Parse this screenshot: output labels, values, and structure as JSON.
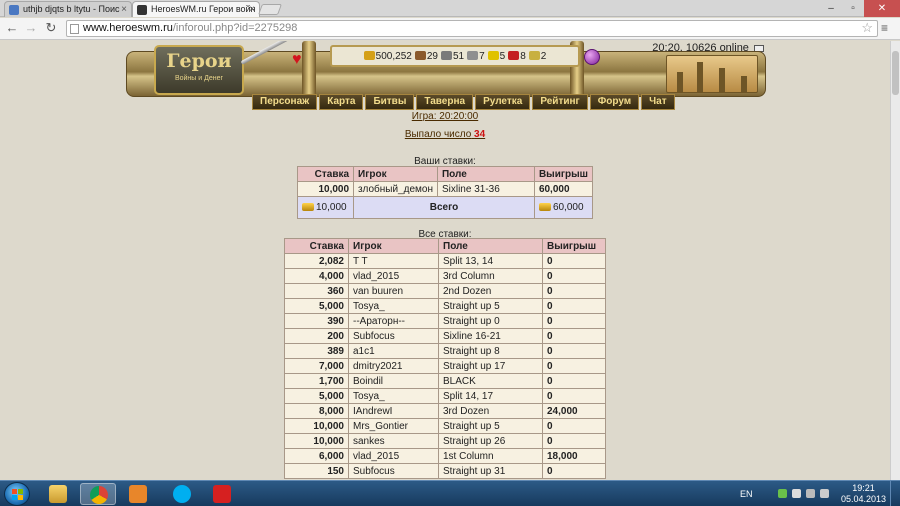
{
  "browser": {
    "tabs": [
      {
        "title": "uthjb djqts b ltytu - Поис"
      },
      {
        "title": "HeroesWM.ru Герои войн"
      }
    ],
    "url_host": "www.heroeswm.ru",
    "url_path": "/inforoul.php?id=2275298"
  },
  "header": {
    "online": "20:20, 10626 online",
    "logo_title": "Герои",
    "logo_subtitle": "Войны и Денег",
    "resources": [
      "500,252",
      "29",
      "51",
      "7",
      "5",
      "8",
      "2"
    ],
    "resource_colors": [
      "#d4a017",
      "#8b5a2b",
      "#7a7a7a",
      "#8f8f8f",
      "#e0c200",
      "#c42020",
      "#c8b040"
    ],
    "nav": [
      "Персонаж",
      "Карта",
      "Битвы",
      "Таверна",
      "Рулетка",
      "Рейтинг",
      "Форум",
      "Чат"
    ]
  },
  "game": {
    "game_link": "Игра: 20:20:00",
    "dropped_label": "Выпало число",
    "dropped_number": "34"
  },
  "your_bets": {
    "caption": "Ваши ставки:",
    "headers": [
      "Ставка",
      "Игрок",
      "Поле",
      "Выигрыш"
    ],
    "rows": [
      {
        "stake": "10,000",
        "player": "злобный_демон",
        "field": "Sixline 31-36",
        "win": "60,000"
      }
    ],
    "total_stake": "10,000",
    "total_label": "Всего",
    "total_win": "60,000"
  },
  "all_bets": {
    "caption": "Все ставки:",
    "headers": [
      "Ставка",
      "Игрок",
      "Поле",
      "Выигрыш"
    ],
    "rows": [
      {
        "stake": "2,082",
        "player": "T T",
        "field": "Split 13, 14",
        "win": "0"
      },
      {
        "stake": "4,000",
        "player": "vlad_2015",
        "field": "3rd Column",
        "win": "0"
      },
      {
        "stake": "360",
        "player": "van buuren",
        "field": "2nd Dozen",
        "win": "0"
      },
      {
        "stake": "5,000",
        "player": "Tosya_",
        "field": "Straight up 5",
        "win": "0"
      },
      {
        "stake": "390",
        "player": "--Араторн--",
        "field": "Straight up 0",
        "win": "0"
      },
      {
        "stake": "200",
        "player": "Subfocus",
        "field": "Sixline 16-21",
        "win": "0"
      },
      {
        "stake": "389",
        "player": "a1c1",
        "field": "Straight up 8",
        "win": "0"
      },
      {
        "stake": "7,000",
        "player": "dmitry2021",
        "field": "Straight up 17",
        "win": "0"
      },
      {
        "stake": "1,700",
        "player": "Boindil",
        "field": "BLACK",
        "win": "0"
      },
      {
        "stake": "5,000",
        "player": "Tosya_",
        "field": "Split 14, 17",
        "win": "0"
      },
      {
        "stake": "8,000",
        "player": "IAndrewI",
        "field": "3rd Dozen",
        "win": "24,000"
      },
      {
        "stake": "10,000",
        "player": "Mrs_Gontier",
        "field": "Straight up 5",
        "win": "0"
      },
      {
        "stake": "10,000",
        "player": "sankes",
        "field": "Straight up 26",
        "win": "0"
      },
      {
        "stake": "6,000",
        "player": "vlad_2015",
        "field": "1st Column",
        "win": "18,000"
      },
      {
        "stake": "150",
        "player": "Subfocus",
        "field": "Straight up 31",
        "win": "0"
      }
    ]
  },
  "taskbar": {
    "lang": "EN",
    "time": "19:21",
    "date": "05.04.2013",
    "apps": [
      "explorer-icon",
      "chrome-icon",
      "media-player-icon",
      "skype-icon",
      "app-icon"
    ]
  }
}
